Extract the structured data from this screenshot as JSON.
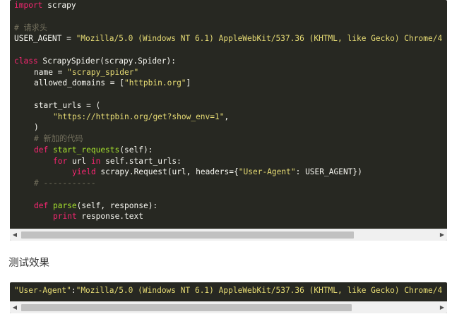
{
  "code_block_1": {
    "lines": [
      {
        "indent": 0,
        "tokens": [
          {
            "t": "kw",
            "v": "import"
          },
          {
            "t": "p",
            "v": " scrapy"
          }
        ]
      },
      {
        "indent": 0,
        "tokens": []
      },
      {
        "indent": 0,
        "tokens": [
          {
            "t": "cm",
            "v": "# 请求头"
          }
        ]
      },
      {
        "indent": 0,
        "tokens": [
          {
            "t": "p",
            "v": "USER_AGENT = "
          },
          {
            "t": "str",
            "v": "\"Mozilla/5.0 (Windows NT 6.1) AppleWebKit/537.36 (KHTML, like Gecko) Chrome/4"
          }
        ]
      },
      {
        "indent": 0,
        "tokens": []
      },
      {
        "indent": 0,
        "tokens": [
          {
            "t": "kw",
            "v": "class"
          },
          {
            "t": "p",
            "v": " ScrapySpider(scrapy.Spider):"
          }
        ]
      },
      {
        "indent": 1,
        "tokens": [
          {
            "t": "p",
            "v": "name = "
          },
          {
            "t": "str",
            "v": "\"scrapy_spider\""
          }
        ]
      },
      {
        "indent": 1,
        "tokens": [
          {
            "t": "p",
            "v": "allowed_domains = ["
          },
          {
            "t": "str",
            "v": "\"httpbin.org\""
          },
          {
            "t": "p",
            "v": "]"
          }
        ]
      },
      {
        "indent": 0,
        "tokens": []
      },
      {
        "indent": 1,
        "tokens": [
          {
            "t": "p",
            "v": "start_urls = ("
          }
        ]
      },
      {
        "indent": 2,
        "tokens": [
          {
            "t": "str",
            "v": "\"https://httpbin.org/get?show_env=1\""
          },
          {
            "t": "p",
            "v": ","
          }
        ]
      },
      {
        "indent": 1,
        "tokens": [
          {
            "t": "p",
            "v": ")"
          }
        ]
      },
      {
        "indent": 1,
        "tokens": [
          {
            "t": "cm",
            "v": "# 新加的代码"
          }
        ]
      },
      {
        "indent": 1,
        "tokens": [
          {
            "t": "kw",
            "v": "def"
          },
          {
            "t": "p",
            "v": " "
          },
          {
            "t": "fn",
            "v": "start_requests"
          },
          {
            "t": "p",
            "v": "(self):"
          }
        ]
      },
      {
        "indent": 2,
        "tokens": [
          {
            "t": "kw",
            "v": "for"
          },
          {
            "t": "p",
            "v": " url "
          },
          {
            "t": "kw",
            "v": "in"
          },
          {
            "t": "p",
            "v": " self.start_urls:"
          }
        ]
      },
      {
        "indent": 3,
        "tokens": [
          {
            "t": "kw",
            "v": "yield"
          },
          {
            "t": "p",
            "v": " scrapy.Request(url, headers={"
          },
          {
            "t": "str",
            "v": "\"User-Agent\""
          },
          {
            "t": "p",
            "v": ": USER_AGENT})"
          }
        ]
      },
      {
        "indent": 1,
        "tokens": [
          {
            "t": "cm",
            "v": "# -----------"
          }
        ]
      },
      {
        "indent": 0,
        "tokens": []
      },
      {
        "indent": 1,
        "tokens": [
          {
            "t": "kw",
            "v": "def"
          },
          {
            "t": "p",
            "v": " "
          },
          {
            "t": "fn",
            "v": "parse"
          },
          {
            "t": "p",
            "v": "(self, response):"
          }
        ]
      },
      {
        "indent": 2,
        "tokens": [
          {
            "t": "kw",
            "v": "print"
          },
          {
            "t": "p",
            "v": " response.text"
          }
        ]
      }
    ]
  },
  "section_heading": "测试效果",
  "code_block_2": {
    "lines": [
      {
        "indent": 0,
        "tokens": [
          {
            "t": "str",
            "v": "\"User-Agent\""
          },
          {
            "t": "p",
            "v": ":"
          },
          {
            "t": "str",
            "v": "\"Mozilla/5.0 (Windows NT 6.1) AppleWebKit/537.36 (KHTML, like Gecko) Chrome/4"
          }
        ]
      }
    ]
  },
  "scrollbar": {
    "left_arrow": "◀",
    "right_arrow": "▶"
  },
  "colors": {
    "code_background": "#272822",
    "keyword": "#f92672",
    "string": "#e6db74",
    "comment": "#75715e",
    "function_name": "#a6e22e",
    "plain": "#f8f8f2"
  }
}
